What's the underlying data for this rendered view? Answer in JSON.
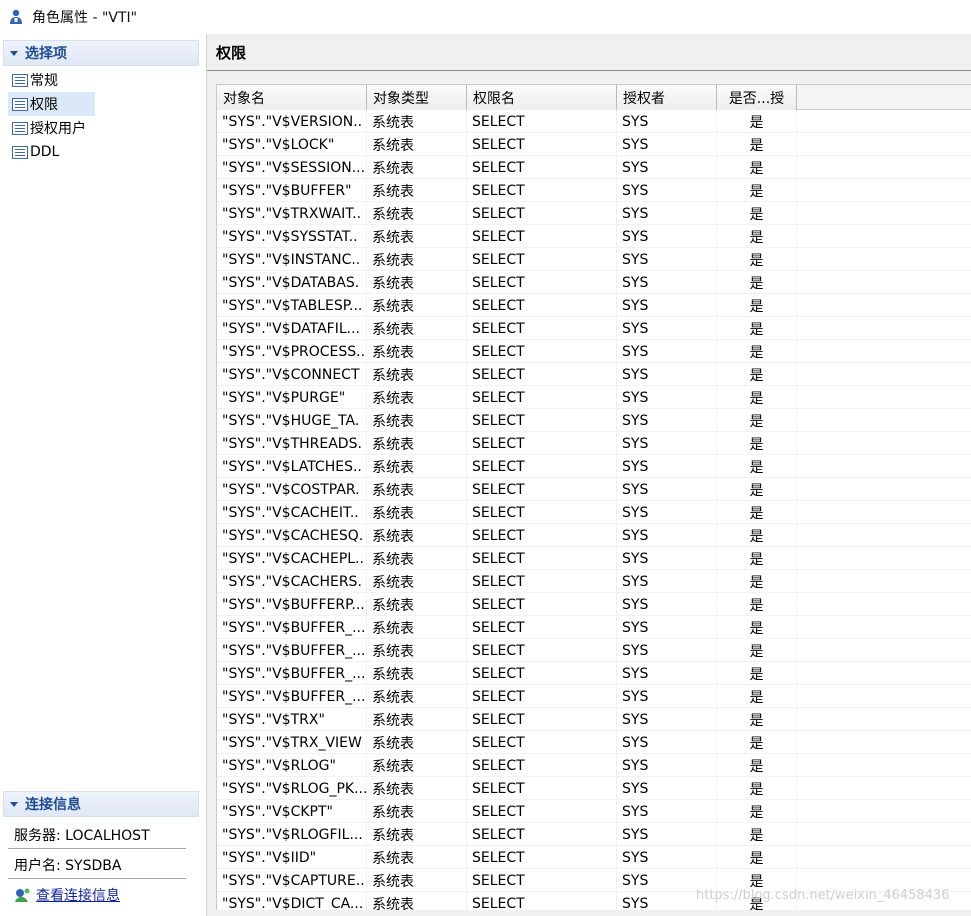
{
  "window": {
    "title": "角色属性 - \"VTI\""
  },
  "sidebar": {
    "section_label": "选择项",
    "items": [
      {
        "label": "常规"
      },
      {
        "label": "权限"
      },
      {
        "label": "授权用户"
      },
      {
        "label": "DDL"
      }
    ]
  },
  "connection": {
    "section_label": "连接信息",
    "server": "服务器: LOCALHOST",
    "user": "用户名: SYSDBA",
    "view_link": "查看连接信息"
  },
  "panel": {
    "title": "权限"
  },
  "table": {
    "headers": [
      "对象名",
      "对象类型",
      "权限名",
      "授权者",
      "是否...授"
    ],
    "rows": [
      [
        "\"SYS\".\"V$VERSION..",
        "系统表",
        "SELECT",
        "SYS",
        "是"
      ],
      [
        "\"SYS\".\"V$LOCK\"",
        "系统表",
        "SELECT",
        "SYS",
        "是"
      ],
      [
        "\"SYS\".\"V$SESSION...",
        "系统表",
        "SELECT",
        "SYS",
        "是"
      ],
      [
        "\"SYS\".\"V$BUFFER\"",
        "系统表",
        "SELECT",
        "SYS",
        "是"
      ],
      [
        "\"SYS\".\"V$TRXWAIT..",
        "系统表",
        "SELECT",
        "SYS",
        "是"
      ],
      [
        "\"SYS\".\"V$SYSSTAT..",
        "系统表",
        "SELECT",
        "SYS",
        "是"
      ],
      [
        "\"SYS\".\"V$INSTANC..",
        "系统表",
        "SELECT",
        "SYS",
        "是"
      ],
      [
        "\"SYS\".\"V$DATABAS.",
        "系统表",
        "SELECT",
        "SYS",
        "是"
      ],
      [
        "\"SYS\".\"V$TABLESP...",
        "系统表",
        "SELECT",
        "SYS",
        "是"
      ],
      [
        "\"SYS\".\"V$DATAFIL...",
        "系统表",
        "SELECT",
        "SYS",
        "是"
      ],
      [
        "\"SYS\".\"V$PROCESS...",
        "系统表",
        "SELECT",
        "SYS",
        "是"
      ],
      [
        "\"SYS\".\"V$CONNECT",
        "系统表",
        "SELECT",
        "SYS",
        "是"
      ],
      [
        "\"SYS\".\"V$PURGE\"",
        "系统表",
        "SELECT",
        "SYS",
        "是"
      ],
      [
        "\"SYS\".\"V$HUGE_TA.",
        "系统表",
        "SELECT",
        "SYS",
        "是"
      ],
      [
        "\"SYS\".\"V$THREADS.",
        "系统表",
        "SELECT",
        "SYS",
        "是"
      ],
      [
        "\"SYS\".\"V$LATCHES..",
        "系统表",
        "SELECT",
        "SYS",
        "是"
      ],
      [
        "\"SYS\".\"V$COSTPAR.",
        "系统表",
        "SELECT",
        "SYS",
        "是"
      ],
      [
        "\"SYS\".\"V$CACHEIT..",
        "系统表",
        "SELECT",
        "SYS",
        "是"
      ],
      [
        "\"SYS\".\"V$CACHESQ.",
        "系统表",
        "SELECT",
        "SYS",
        "是"
      ],
      [
        "\"SYS\".\"V$CACHEPL..",
        "系统表",
        "SELECT",
        "SYS",
        "是"
      ],
      [
        "\"SYS\".\"V$CACHERS.",
        "系统表",
        "SELECT",
        "SYS",
        "是"
      ],
      [
        "\"SYS\".\"V$BUFFERP...",
        "系统表",
        "SELECT",
        "SYS",
        "是"
      ],
      [
        "\"SYS\".\"V$BUFFER_...",
        "系统表",
        "SELECT",
        "SYS",
        "是"
      ],
      [
        "\"SYS\".\"V$BUFFER_...",
        "系统表",
        "SELECT",
        "SYS",
        "是"
      ],
      [
        "\"SYS\".\"V$BUFFER_...",
        "系统表",
        "SELECT",
        "SYS",
        "是"
      ],
      [
        "\"SYS\".\"V$BUFFER_...",
        "系统表",
        "SELECT",
        "SYS",
        "是"
      ],
      [
        "\"SYS\".\"V$TRX\"",
        "系统表",
        "SELECT",
        "SYS",
        "是"
      ],
      [
        "\"SYS\".\"V$TRX_VIEW",
        "系统表",
        "SELECT",
        "SYS",
        "是"
      ],
      [
        "\"SYS\".\"V$RLOG\"",
        "系统表",
        "SELECT",
        "SYS",
        "是"
      ],
      [
        "\"SYS\".\"V$RLOG_PK...",
        "系统表",
        "SELECT",
        "SYS",
        "是"
      ],
      [
        "\"SYS\".\"V$CKPT\"",
        "系统表",
        "SELECT",
        "SYS",
        "是"
      ],
      [
        "\"SYS\".\"V$RLOGFIL...",
        "系统表",
        "SELECT",
        "SYS",
        "是"
      ],
      [
        "\"SYS\".\"V$IID\"",
        "系统表",
        "SELECT",
        "SYS",
        "是"
      ],
      [
        "\"SYS\".\"V$CAPTURE..",
        "系统表",
        "SELECT",
        "SYS",
        "是"
      ],
      [
        "\"SYS\".\"V$DICT_CA...",
        "系统表",
        "SELECT",
        "SYS",
        "是"
      ]
    ]
  },
  "watermark": "https://blog.csdn.net/weixin_46458436",
  "colors": {
    "accent": "#1f4b93",
    "link": "#10239e",
    "selected_bg": "#dbe8f8"
  }
}
